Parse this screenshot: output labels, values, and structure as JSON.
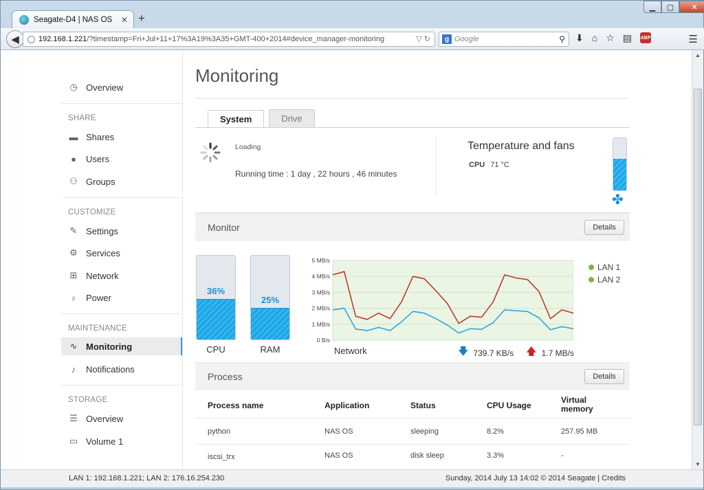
{
  "browser": {
    "tab_title": "Seagate-D4 | NAS OS",
    "url_host": "192.168.1.221",
    "url_rest": "/?timestamp=Fri+Jul+11+17%3A19%3A35+GMT-400+2014#device_manager-monitoring",
    "search_placeholder": "Google"
  },
  "sidebar": {
    "overview": "Overview",
    "share_head": "SHARE",
    "shares": "Shares",
    "users": "Users",
    "groups": "Groups",
    "customize_head": "CUSTOMIZE",
    "settings": "Settings",
    "services": "Services",
    "network": "Network",
    "power": "Power",
    "maintenance_head": "MAINTENANCE",
    "monitoring": "Monitoring",
    "notifications": "Notifications",
    "storage_head": "STORAGE",
    "storage_overview": "Overview",
    "volume": "Volume 1"
  },
  "main": {
    "title": "Monitoring",
    "tabs": [
      {
        "label": "System"
      },
      {
        "label": "Drive"
      }
    ],
    "system": {
      "loading": "Loading",
      "running_time": "Running time : 1 day , 22 hours , 46 minutes",
      "temp_title": "Temperature and fans",
      "cpu_label": "CPU",
      "cpu_temp": "71 °C",
      "therm_level": 0.6
    },
    "monitor": {
      "label": "Monitor",
      "details": "Details",
      "cpu_pct": 36,
      "cpu_pct_text": "36%",
      "cpu_label": "CPU",
      "ram_pct": 25,
      "ram_pct_text": "25%",
      "ram_label": "RAM",
      "network_label": "Network",
      "down_rate": "739.7 KB/s",
      "up_rate": "1.7 MB/s",
      "legend": [
        "LAN 1",
        "LAN 2"
      ]
    },
    "process": {
      "label": "Process",
      "details": "Details",
      "headers": [
        "Process name",
        "Application",
        "Status",
        "CPU Usage",
        "Virtual memory"
      ],
      "rows": [
        [
          "python",
          "NAS OS",
          "sleeping",
          "8.2%",
          "257.95 MB"
        ],
        [
          "iscsi_trx",
          "NAS OS",
          "disk sleep",
          "3.3%",
          "-"
        ]
      ]
    }
  },
  "status": {
    "left": "LAN 1: 192.168.1.221; LAN 2: 176.16.254.230",
    "right": "Sunday, 2014 July 13   14:02   © 2014 Seagate | Credits"
  },
  "chart_data": {
    "type": "line",
    "x": [
      0,
      1,
      2,
      3,
      4,
      5,
      6,
      7,
      8,
      9,
      10,
      11,
      12,
      13,
      14,
      15,
      16,
      17,
      18,
      19,
      20
    ],
    "ylim": [
      0,
      5
    ],
    "yticks": [
      "0 B/s",
      "1 MB/s",
      "2 MB/s",
      "3 MB/s",
      "4 MB/s",
      "5 MB/s"
    ],
    "series": [
      {
        "name": "LAN 1",
        "color": "#c0392b",
        "values": [
          4.1,
          4.3,
          1.5,
          1.3,
          1.7,
          1.35,
          2.4,
          4.0,
          3.85,
          3.1,
          2.3,
          1.05,
          1.5,
          1.45,
          2.4,
          4.1,
          3.9,
          3.8,
          3.05,
          1.35,
          1.9,
          1.7
        ]
      },
      {
        "name": "LAN 2",
        "color": "#2ea8dc",
        "values": [
          1.9,
          2.0,
          0.7,
          0.6,
          0.8,
          0.6,
          1.15,
          1.8,
          1.7,
          1.35,
          0.95,
          0.45,
          0.72,
          0.68,
          1.1,
          1.9,
          1.85,
          1.8,
          1.4,
          0.65,
          0.85,
          0.72
        ]
      }
    ]
  }
}
